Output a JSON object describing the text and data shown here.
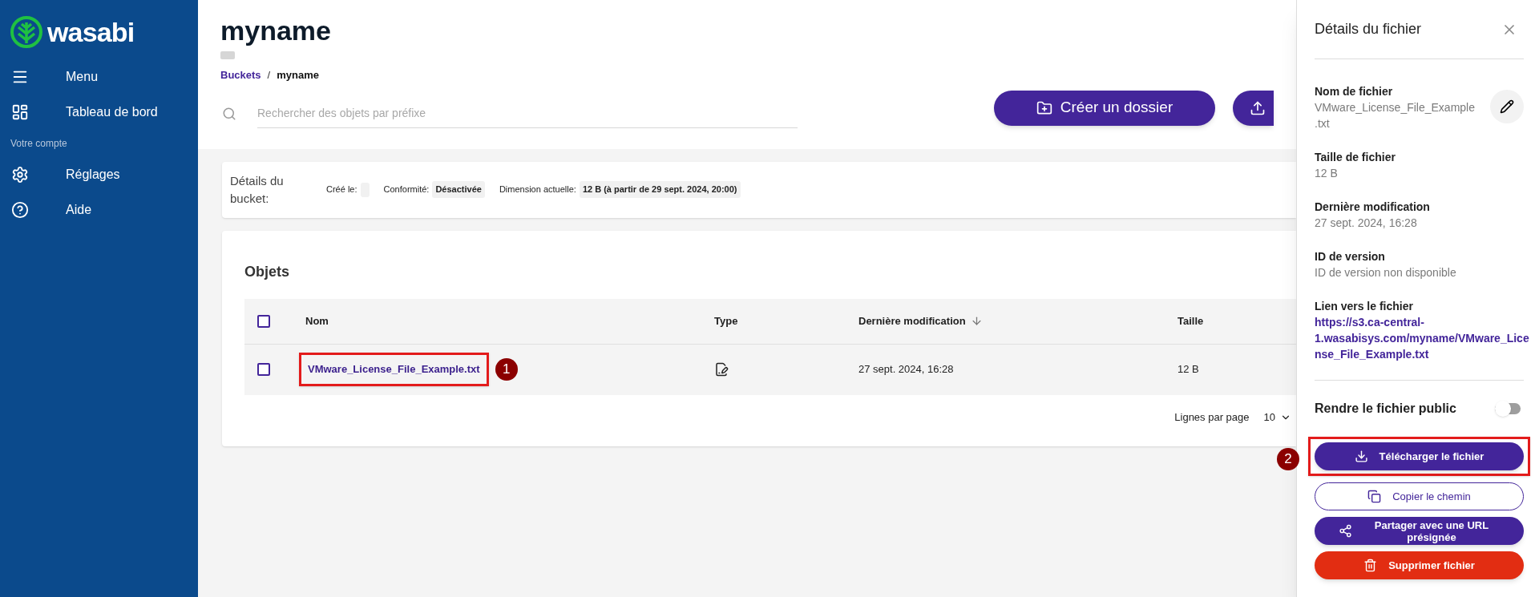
{
  "sidebar": {
    "logo": "wasabi",
    "items": [
      {
        "label": "Menu",
        "kind": "menu"
      },
      {
        "label": "Tableau de bord",
        "kind": "dashboard"
      }
    ],
    "section": "Votre compte",
    "account_items": [
      {
        "label": "Réglages",
        "kind": "settings"
      },
      {
        "label": "Aide",
        "kind": "help"
      }
    ]
  },
  "header": {
    "title": "myname",
    "breadcrumb": [
      {
        "label": "Buckets",
        "link": true
      },
      {
        "label": "myname",
        "link": false
      }
    ],
    "separator": "/",
    "search": {
      "placeholder": "Rechercher des objets par préfixe"
    },
    "buttons": [
      {
        "label": "Créer un dossier",
        "kind": "create-folder"
      },
      {
        "kind": "upload"
      }
    ]
  },
  "bucket_details": {
    "title": "Détails du bucket:",
    "fields": [
      {
        "label": "Créé le:"
      },
      {
        "label": "Conformité:",
        "value": "Désactivée"
      },
      {
        "label": "Dimension actuelle:",
        "value": "12 B (à partir de 29 sept. 2024, 20:00)"
      }
    ]
  },
  "objects": {
    "title": "Objets",
    "header_checked": false,
    "columns": [
      {
        "label": "Nom",
        "sorted": false
      },
      {
        "label": "Type",
        "sorted": false
      },
      {
        "label": "Dernière modification",
        "sorted": true
      },
      {
        "label": "Taille",
        "sorted": false
      }
    ],
    "rows": [
      {
        "checked": false,
        "name": "VMware_License_File_Example.txt",
        "date": "27 sept. 2024, 16:28",
        "size": "12 B",
        "annotation": "1"
      }
    ],
    "pagination": {
      "label": "Lignes par page",
      "value": "10"
    }
  },
  "file_panel": {
    "title": "Détails du fichier",
    "fields": [
      {
        "label": "Nom de fichier",
        "value": "VMware_License_File_Example.txt",
        "kind": "text",
        "editable": true
      },
      {
        "label": "Taille de fichier",
        "value": "12 B",
        "kind": "text",
        "editable": false
      },
      {
        "label": "Dernière modification",
        "value": "27 sept. 2024, 16:28",
        "kind": "text",
        "editable": false
      },
      {
        "label": "ID de version",
        "value": "ID de version non disponible",
        "kind": "text",
        "editable": false
      },
      {
        "label": "Lien vers le fichier",
        "value": "https://s3.ca-central-1.wasabisys.com/myname/VMware_License_File_Example.txt",
        "kind": "link",
        "editable": false
      }
    ],
    "public_toggle": {
      "label": "Rendre le fichier public",
      "on": false
    },
    "actions": [
      {
        "label": "Télécharger le fichier",
        "kind": "download",
        "annotation": "2"
      },
      {
        "label": "Copier le chemin",
        "kind": "copy"
      },
      {
        "label": "Partager avec une URL présignée",
        "kind": "share"
      },
      {
        "label": "Supprimer fichier",
        "kind": "delete"
      }
    ]
  }
}
